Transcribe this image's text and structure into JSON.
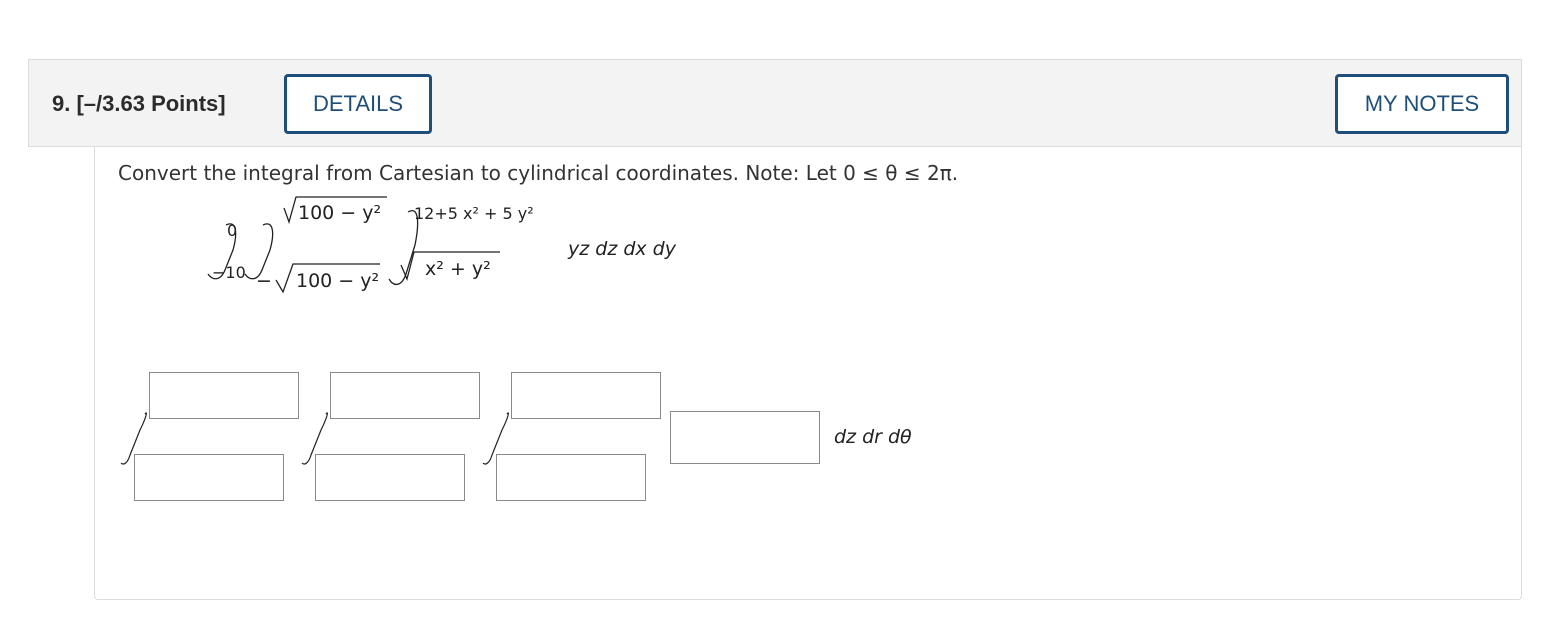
{
  "question": {
    "header": "9. [–/3.63 Points]",
    "details_label": "DETAILS",
    "notes_label": "MY NOTES",
    "prompt": "Convert the integral from Cartesian to cylindrical coordinates. Note: Let 0 ≤ θ ≤ 2π."
  },
  "given_integral": {
    "outer_lower": "−10",
    "outer_upper": "0",
    "middle_lower": "100 − y²",
    "middle_upper": "100 − y²",
    "inner_lower": "x² + y²",
    "inner_upper": "12+5 x² + 5 y²",
    "integrand": "yz dz dx dy"
  },
  "answer": {
    "bounds": [
      {
        "upper": "",
        "lower": ""
      },
      {
        "upper": "",
        "lower": ""
      },
      {
        "upper": "",
        "lower": ""
      }
    ],
    "integrand_value": "",
    "differentials": "dz dr dθ"
  }
}
